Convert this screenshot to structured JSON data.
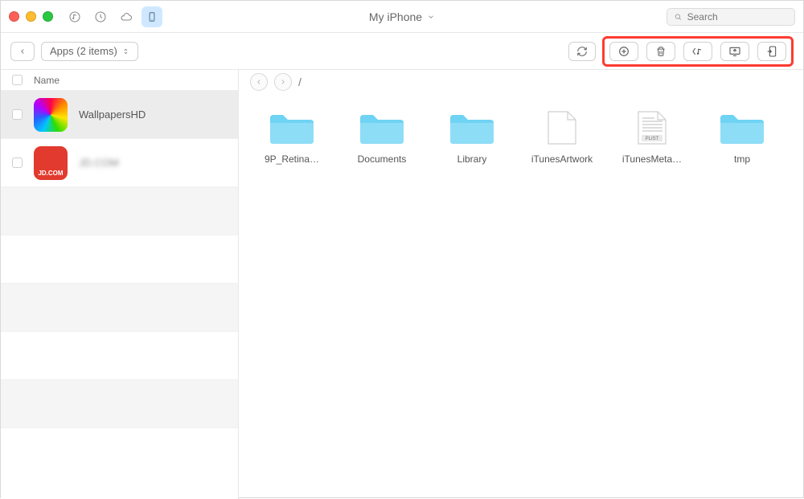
{
  "title": "My iPhone",
  "search": {
    "placeholder": "Search"
  },
  "backcrumb": "Apps (2 items)",
  "sidebar": {
    "header": "Name",
    "apps": [
      {
        "name": "WallpapersHD",
        "icon": "rainbow",
        "selected": true
      },
      {
        "name": "JD.COM",
        "icon": "jd",
        "blurred": true
      }
    ]
  },
  "path": "/",
  "items": [
    {
      "type": "folder",
      "name": "9P_Retina…"
    },
    {
      "type": "folder",
      "name": "Documents"
    },
    {
      "type": "folder",
      "name": "Library"
    },
    {
      "type": "file",
      "name": "iTunesArtwork"
    },
    {
      "type": "plist",
      "name": "iTunesMeta…"
    },
    {
      "type": "folder",
      "name": "tmp"
    }
  ],
  "icons": {
    "folder_color": "#6fd3f4",
    "highlight": "#ff3b30"
  }
}
